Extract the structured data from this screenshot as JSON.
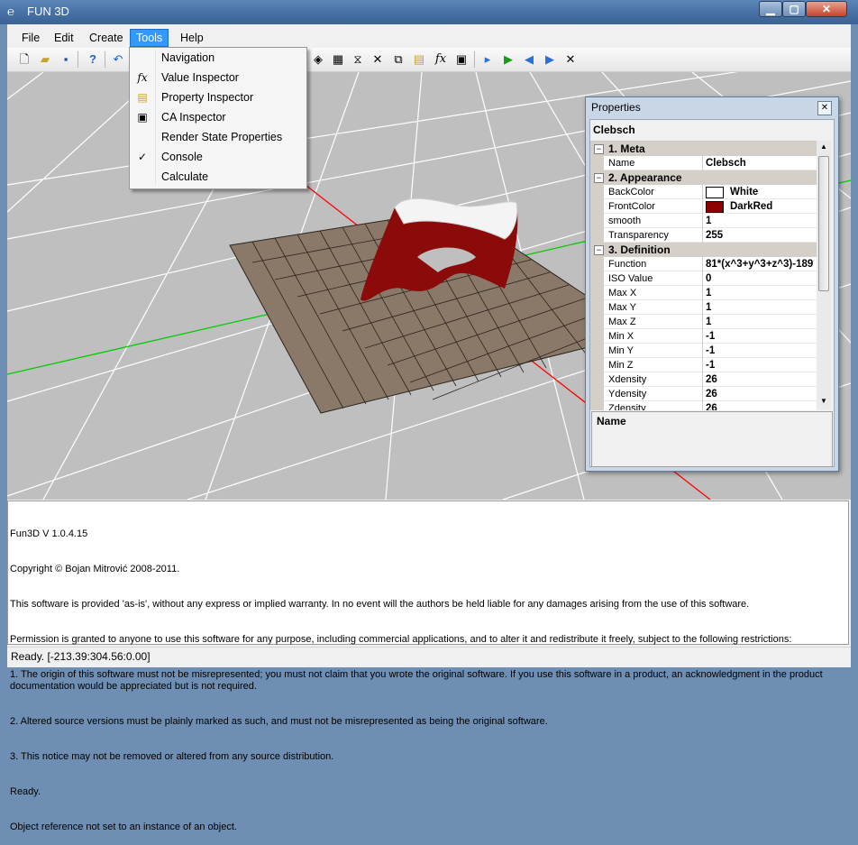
{
  "window": {
    "title": "FUN 3D",
    "min": "▁",
    "max": "▢",
    "close": "✕"
  },
  "menubar": [
    "File",
    "Edit",
    "Create",
    "Tools",
    "Help"
  ],
  "tools_menu": {
    "items": [
      {
        "label": "Navigation",
        "icon": "",
        "checked": false
      },
      {
        "label": "Value Inspector",
        "icon": "function-icon",
        "checked": false
      },
      {
        "label": "Property Inspector",
        "icon": "property-icon",
        "checked": false
      },
      {
        "label": "CA Inspector",
        "icon": "ca-icon",
        "checked": false
      },
      {
        "label": "Render State Properties",
        "icon": "",
        "checked": false
      },
      {
        "label": "Console",
        "icon": "",
        "checked": true
      },
      {
        "label": "Calculate",
        "icon": "",
        "checked": false
      }
    ]
  },
  "properties": {
    "title": "Properties",
    "object_name": "Clebsch",
    "categories": [
      {
        "label": "1. Meta",
        "rows": [
          {
            "key": "Name",
            "value": "Clebsch"
          }
        ]
      },
      {
        "label": "2. Appearance",
        "rows": [
          {
            "key": "BackColor",
            "value": "White",
            "swatch": "#ffffff"
          },
          {
            "key": "FrontColor",
            "value": "DarkRed",
            "swatch": "#8b0000"
          },
          {
            "key": "smooth",
            "value": "1"
          },
          {
            "key": "Transparency",
            "value": "255"
          }
        ]
      },
      {
        "label": "3. Definition",
        "rows": [
          {
            "key": "Function",
            "value": "81*(x^3+y^3+z^3)-189"
          },
          {
            "key": "ISO Value",
            "value": "0"
          },
          {
            "key": "Max X",
            "value": "1"
          },
          {
            "key": "Max Y",
            "value": "1"
          },
          {
            "key": "Max Z",
            "value": "1"
          },
          {
            "key": "Min X",
            "value": "-1"
          },
          {
            "key": "Min Y",
            "value": "-1"
          },
          {
            "key": "Min Z",
            "value": "-1"
          },
          {
            "key": "Xdensity",
            "value": "26"
          },
          {
            "key": "Ydensity",
            "value": "26"
          },
          {
            "key": "Zdensity",
            "value": "26"
          }
        ]
      }
    ],
    "help_title": "Name"
  },
  "console": {
    "lines": [
      "Fun3D V 1.0.4.15",
      "Copyright © Bojan Mitrović 2008-2011.",
      "This software is provided 'as-is', without any express or implied warranty. In no event will the authors be held liable for any damages arising from the use of this software.",
      "Permission is granted to anyone to use this software for any purpose, including commercial applications, and to alter it and redistribute it freely, subject to the following restrictions:",
      "1. The origin of this software must not be misrepresented; you must not claim that you wrote the original software. If you use this software in a product, an acknowledgment in the product documentation would be appreciated but is not required.",
      "2. Altered source versions must be plainly marked as such, and must not be misrepresented as being the original software.",
      "3. This notice may not be removed or altered from any source distribution.",
      "Ready.",
      "Object reference not set to an instance of an object."
    ]
  },
  "status": "Ready.   [-213.39:304.56:0.00]",
  "colors": {
    "surface_red": "#8b0a0a",
    "plane": "#8a7968",
    "axis_red": "#ff0000",
    "axis_green": "#00cc00"
  }
}
